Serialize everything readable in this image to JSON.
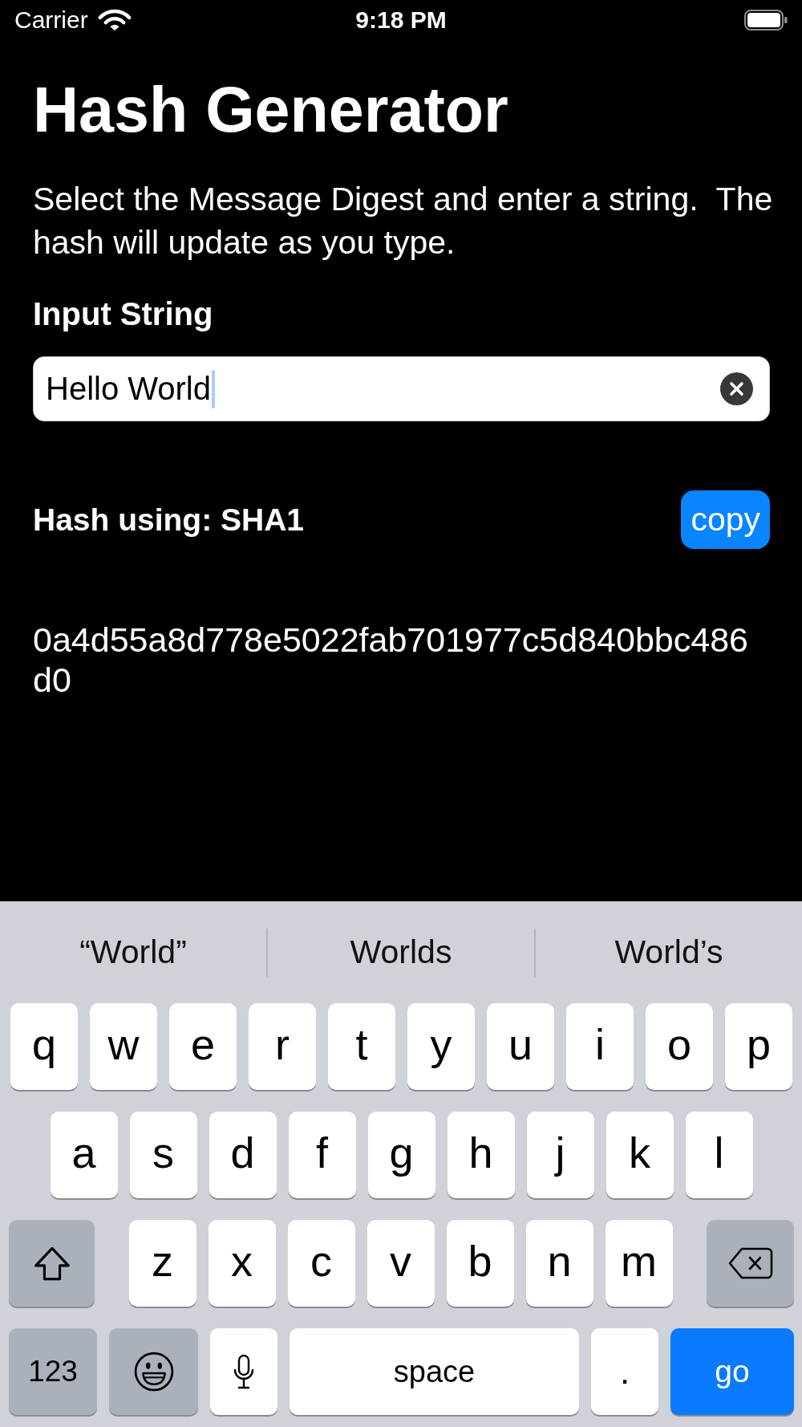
{
  "status_bar": {
    "carrier": "Carrier",
    "time": "9:18 PM"
  },
  "title": "Hash Generator",
  "description": "Select the Message Digest and enter a string.  The hash will update as you type.",
  "input": {
    "label": "Input String",
    "value": "Hello World"
  },
  "hash": {
    "label": "Hash using: SHA1",
    "copy_button": "copy",
    "value": "0a4d55a8d778e5022fab701977c5d840bbc486d0"
  },
  "keyboard": {
    "suggestions": [
      "“World”",
      "Worlds",
      "World’s"
    ],
    "rows": [
      {
        "keys": [
          {
            "kind": "letter",
            "label": "q"
          },
          {
            "kind": "letter",
            "label": "w"
          },
          {
            "kind": "letter",
            "label": "e"
          },
          {
            "kind": "letter",
            "label": "r"
          },
          {
            "kind": "letter",
            "label": "t"
          },
          {
            "kind": "letter",
            "label": "y"
          },
          {
            "kind": "letter",
            "label": "u"
          },
          {
            "kind": "letter",
            "label": "i"
          },
          {
            "kind": "letter",
            "label": "o"
          },
          {
            "kind": "letter",
            "label": "p"
          }
        ]
      },
      {
        "keys": [
          {
            "kind": "letter",
            "label": "a"
          },
          {
            "kind": "letter",
            "label": "s"
          },
          {
            "kind": "letter",
            "label": "d"
          },
          {
            "kind": "letter",
            "label": "f"
          },
          {
            "kind": "letter",
            "label": "g"
          },
          {
            "kind": "letter",
            "label": "h"
          },
          {
            "kind": "letter",
            "label": "j"
          },
          {
            "kind": "letter",
            "label": "k"
          },
          {
            "kind": "letter",
            "label": "l"
          }
        ]
      },
      {
        "keys": [
          {
            "kind": "shift"
          },
          {
            "kind": "letter",
            "label": "z"
          },
          {
            "kind": "letter",
            "label": "x"
          },
          {
            "kind": "letter",
            "label": "c"
          },
          {
            "kind": "letter",
            "label": "v"
          },
          {
            "kind": "letter",
            "label": "b"
          },
          {
            "kind": "letter",
            "label": "n"
          },
          {
            "kind": "letter",
            "label": "m"
          },
          {
            "kind": "delete"
          }
        ]
      },
      {
        "keys": [
          {
            "kind": "numbers",
            "label": "123"
          },
          {
            "kind": "emoji"
          },
          {
            "kind": "mic"
          },
          {
            "kind": "space",
            "label": "space"
          },
          {
            "kind": "period",
            "label": "."
          },
          {
            "kind": "go",
            "label": "go"
          }
        ]
      }
    ]
  }
}
